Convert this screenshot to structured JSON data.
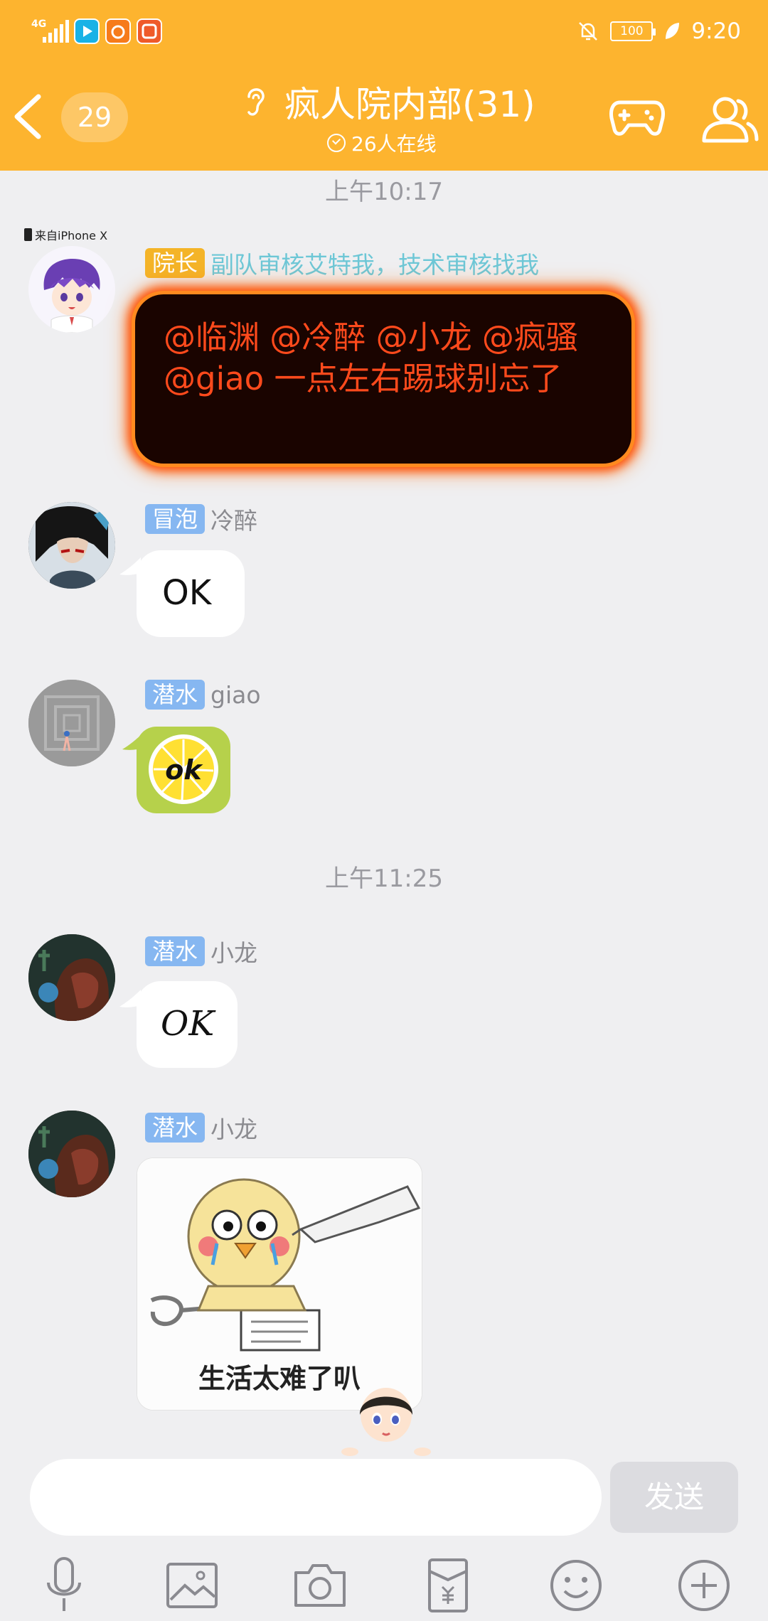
{
  "status_bar": {
    "network": "4G",
    "battery": "100",
    "time": "9:20"
  },
  "header": {
    "unread_count": "29",
    "title": "疯人院内部(31)",
    "online": "26人在线"
  },
  "messages": [
    {
      "type": "time",
      "text": "上午10:17"
    },
    {
      "type": "text",
      "badge": "院长",
      "nick": "副队审核艾特我，技术审核找我",
      "device": "来自iPhone X",
      "text": "@临渊 @冷醉 @小龙 @疯骚 @giao 一点左右踢球别忘了"
    },
    {
      "type": "text",
      "badge": "冒泡",
      "nick": "冷醉",
      "text": "OK"
    },
    {
      "type": "sticker",
      "badge": "潜水",
      "nick": "giao",
      "sticker_text": "ok"
    },
    {
      "type": "time",
      "text": "上午11:25"
    },
    {
      "type": "text",
      "badge": "潜水",
      "nick": "小龙",
      "text": "OK"
    },
    {
      "type": "image",
      "badge": "潜水",
      "nick": "小龙",
      "caption": "生活太难了叭"
    }
  ],
  "input": {
    "placeholder": "",
    "send_label": "发送"
  },
  "toolbar": [
    "mic-icon",
    "image-icon",
    "camera-icon",
    "red-packet-icon",
    "emoji-icon",
    "plus-icon"
  ],
  "colors": {
    "header_bg": "#fdb42f",
    "badge_gold": "#f4b428",
    "badge_blue": "#86b7f1",
    "fire_text": "#ff4a1c"
  }
}
